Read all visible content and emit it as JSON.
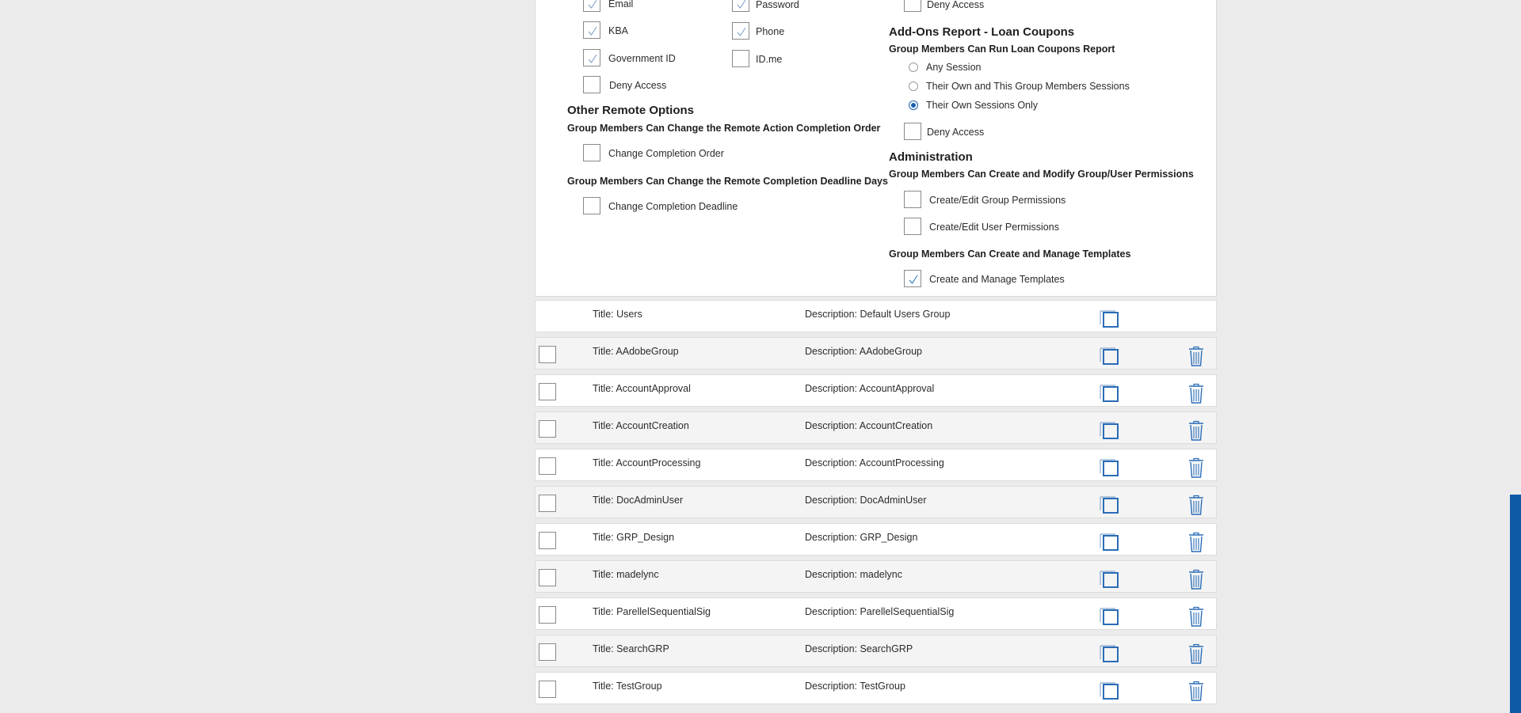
{
  "remote_auth": {
    "email": {
      "label": "Email",
      "checked": true
    },
    "password": {
      "label": "Password",
      "checked": true
    },
    "kba": {
      "label": "KBA",
      "checked": true
    },
    "phone": {
      "label": "Phone",
      "checked": true
    },
    "government_id": {
      "label": "Government ID",
      "checked": true
    },
    "idme": {
      "label": "ID.me",
      "checked": false
    },
    "deny_access": {
      "label": "Deny Access",
      "checked": false
    }
  },
  "top_right_deny": {
    "label": "Deny Access",
    "checked": false
  },
  "other_remote": {
    "title": "Other Remote Options",
    "order_sub": "Group Members Can Change the Remote Action Completion Order",
    "order_label": "Change Completion Order",
    "deadline_sub": "Group Members Can Change the Remote Completion Deadline Days",
    "deadline_label": "Change Completion Deadline"
  },
  "addons": {
    "title": "Add-Ons Report - Loan Coupons",
    "sub": "Group Members Can Run Loan Coupons Report",
    "options": [
      "Any Session",
      "Their Own and This Group Members Sessions",
      "Their Own Sessions Only"
    ],
    "selected": "Their Own Sessions Only",
    "deny_label": "Deny Access"
  },
  "administration": {
    "title": "Administration",
    "perm_sub": "Group Members Can Create and Modify Group/User Permissions",
    "group_perm_label": "Create/Edit Group Permissions",
    "user_perm_label": "Create/Edit User Permissions",
    "templates_sub": "Group Members Can Create and Manage Templates",
    "templates_label": "Create and Manage Templates",
    "templates_checked": true
  },
  "groups": {
    "title_prefix": "Title:",
    "desc_prefix": "Description:",
    "rows": [
      {
        "title": "Users",
        "description": "Default Users Group"
      },
      {
        "title": "AAdobeGroup",
        "description": "AAdobeGroup"
      },
      {
        "title": "AccountApproval",
        "description": "AccountApproval"
      },
      {
        "title": "AccountCreation",
        "description": "AccountCreation"
      },
      {
        "title": "AccountProcessing",
        "description": "AccountProcessing"
      },
      {
        "title": "DocAdminUser",
        "description": "DocAdminUser"
      },
      {
        "title": "GRP_Design",
        "description": "GRP_Design"
      },
      {
        "title": "madelync",
        "description": "madelync"
      },
      {
        "title": "ParellelSequentialSig",
        "description": "ParellelSequentialSig"
      },
      {
        "title": "SearchGRP",
        "description": "SearchGRP"
      },
      {
        "title": "TestGroup",
        "description": "TestGroup"
      }
    ]
  },
  "colors": {
    "accent": "#1a5fb4",
    "icon_blue": "#2a6cb7",
    "scrollbar": "#0e5aa7"
  }
}
